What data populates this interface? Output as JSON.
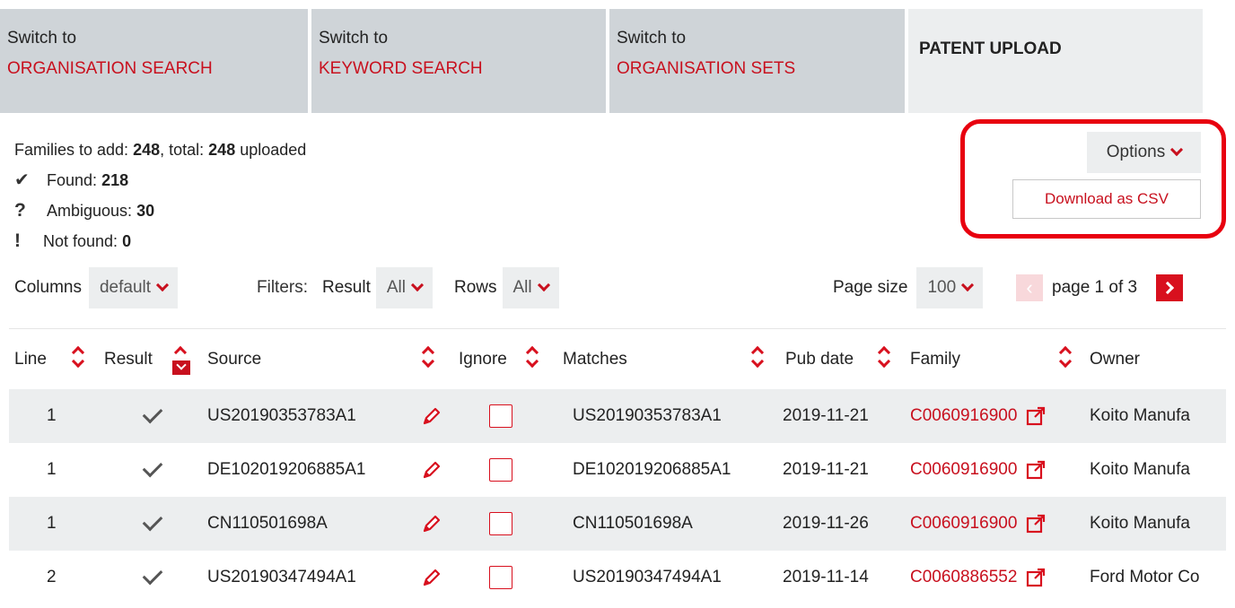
{
  "tabs": [
    {
      "prefix": "Switch to",
      "label": "ORGANISATION SEARCH"
    },
    {
      "prefix": "Switch to",
      "label": "KEYWORD SEARCH"
    },
    {
      "prefix": "Switch to",
      "label": "ORGANISATION SETS"
    },
    {
      "title": "PATENT UPLOAD"
    }
  ],
  "summary": {
    "families_prefix": "Families to add:",
    "families_add": "248",
    "total_prefix": ", total:",
    "total": "248",
    "uploaded_suffix": "uploaded",
    "found_label": "Found:",
    "found": "218",
    "ambiguous_label": "Ambiguous:",
    "ambiguous": "30",
    "notfound_label": "Not found:",
    "notfound": "0"
  },
  "options": {
    "label": "Options",
    "download_csv": "Download as CSV"
  },
  "controls": {
    "columns_label": "Columns",
    "columns_value": "default",
    "filters_label": "Filters:",
    "result_label": "Result",
    "result_value": "All",
    "rows_label": "Rows",
    "rows_value": "All",
    "pagesize_label": "Page size",
    "pagesize_value": "100",
    "page_info": "page 1 of 3"
  },
  "table": {
    "headers": {
      "line": "Line",
      "result": "Result",
      "source": "Source",
      "ignore": "Ignore",
      "matches": "Matches",
      "pubdate": "Pub date",
      "family": "Family",
      "owner": "Owner"
    },
    "rows": [
      {
        "line": "1",
        "source": "US20190353783A1",
        "matches": "US20190353783A1",
        "pubdate": "2019-11-21",
        "family": "C0060916900",
        "owner": "Koito Manufa"
      },
      {
        "line": "1",
        "source": "DE102019206885A1",
        "matches": "DE102019206885A1",
        "pubdate": "2019-11-21",
        "family": "C0060916900",
        "owner": "Koito Manufa"
      },
      {
        "line": "1",
        "source": "CN110501698A",
        "matches": "CN110501698A",
        "pubdate": "2019-11-26",
        "family": "C0060916900",
        "owner": "Koito Manufa"
      },
      {
        "line": "2",
        "source": "US20190347494A1",
        "matches": "US20190347494A1",
        "pubdate": "2019-11-14",
        "family": "C0060886552",
        "owner": "Ford Motor Co"
      }
    ]
  }
}
